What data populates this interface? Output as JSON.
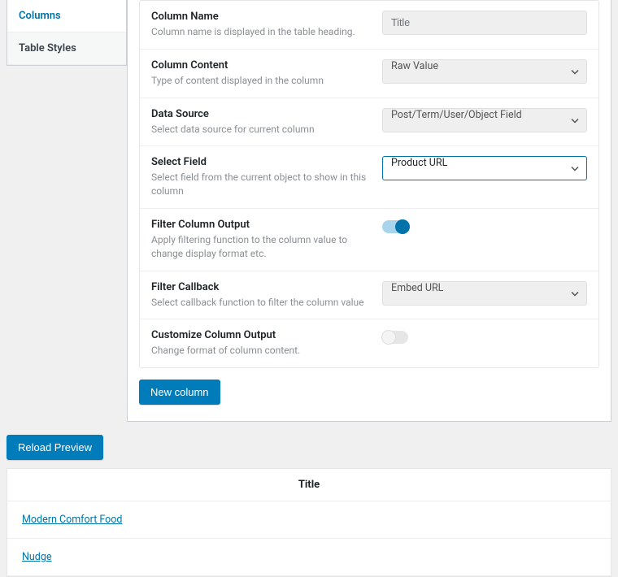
{
  "sidebar": {
    "tabs": [
      {
        "label": "Columns"
      },
      {
        "label": "Table Styles"
      }
    ]
  },
  "form": {
    "columnName": {
      "label": "Column Name",
      "desc": "Column name is displayed in the table heading.",
      "value": "Title"
    },
    "columnContent": {
      "label": "Column Content",
      "desc": "Type of content displayed in the column",
      "value": "Raw Value"
    },
    "dataSource": {
      "label": "Data Source",
      "desc": "Select data source for current column",
      "value": "Post/Term/User/Object Field"
    },
    "selectField": {
      "label": "Select Field",
      "desc": "Select field from the current object to show in this column",
      "value": "Product URL"
    },
    "filterOutput": {
      "label": "Filter Column Output",
      "desc": "Apply filtering function to the column value to change display format etc."
    },
    "filterCallback": {
      "label": "Filter Callback",
      "desc": "Select callback function to filter the column value",
      "value": "Embed URL"
    },
    "customizeOutput": {
      "label": "Customize Column Output",
      "desc": "Change format of column content."
    }
  },
  "buttons": {
    "newColumn": "New column",
    "reloadPreview": "Reload Preview"
  },
  "preview": {
    "header": "Title",
    "rows": [
      {
        "link": "Modern Comfort Food"
      },
      {
        "link": "Nudge"
      }
    ]
  }
}
